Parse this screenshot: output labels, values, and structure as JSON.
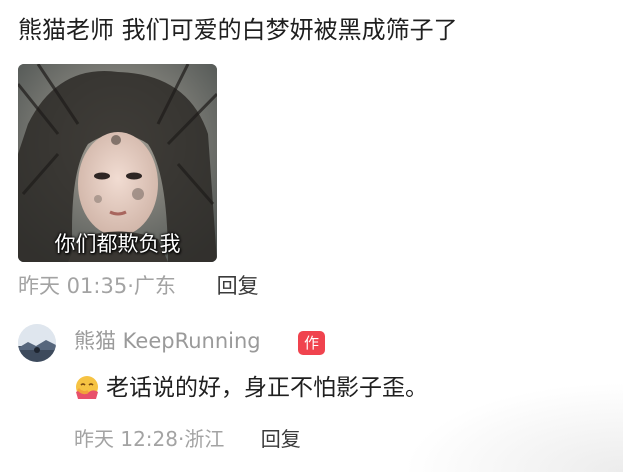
{
  "comment": {
    "text": "熊猫老师 我们可爱的白梦妍被黑成筛子了",
    "image_caption": "你们都欺负我",
    "time": "昨天 01:35",
    "location_separator": "·",
    "location": "广东",
    "reply_label": "回复"
  },
  "reply": {
    "author": "熊猫 KeepRunning",
    "badge": "作者",
    "emoji": "hug-emoji",
    "text": "老话说的好，身正不怕影子歪。",
    "time": "昨天 12:28",
    "location_separator": "·",
    "location": "浙江",
    "reply_label": "回复"
  },
  "colors": {
    "badge": "#f0434e",
    "meta_text": "#a3a3a3",
    "primary_text": "#1f1f1f"
  }
}
